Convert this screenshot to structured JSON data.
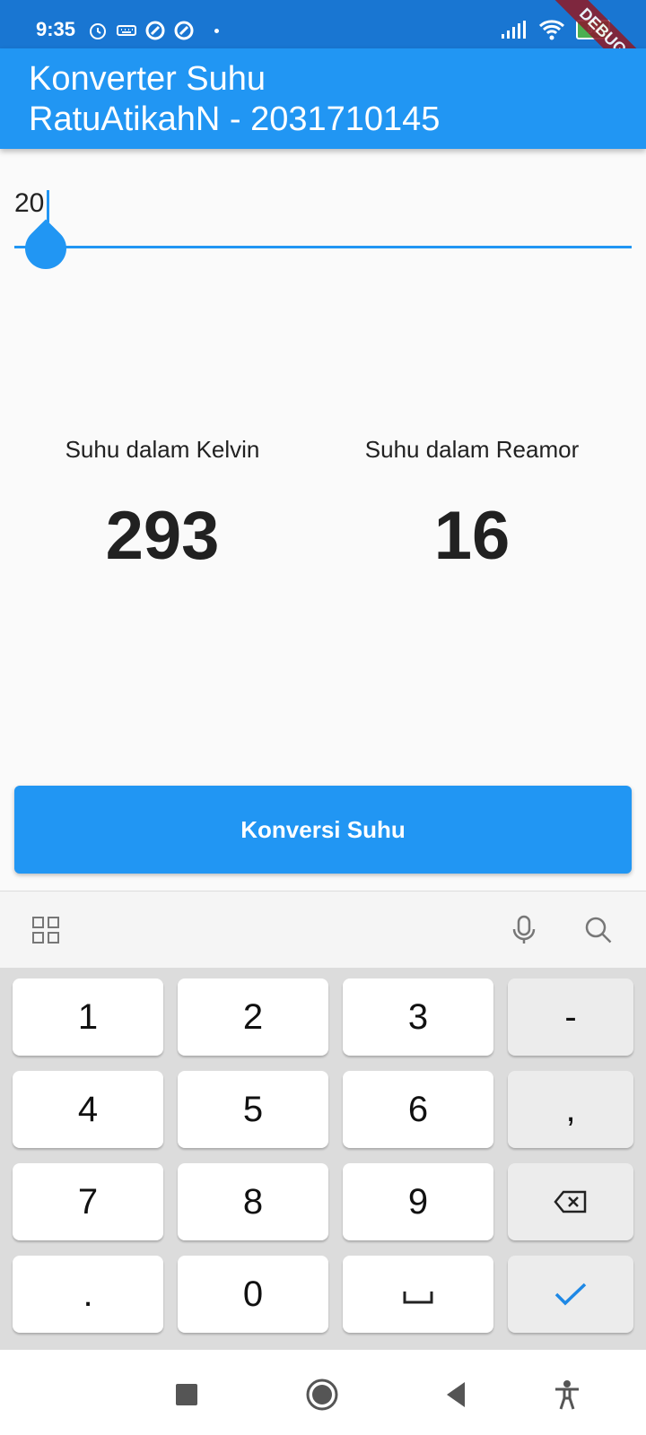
{
  "status": {
    "time": "9:35",
    "battery": "99"
  },
  "debug_banner": "DEBUG",
  "appbar": {
    "title": "Konverter Suhu",
    "subtitle": "RatuAtikahN - 2031710145"
  },
  "input": {
    "value": "20"
  },
  "results": {
    "kelvin_label": "Suhu dalam Kelvin",
    "kelvin_value": "293",
    "reamur_label": "Suhu dalam Reamor",
    "reamur_value": "16"
  },
  "button": {
    "label": "Konversi Suhu"
  },
  "keyboard": {
    "rows": [
      [
        "1",
        "2",
        "3",
        "-"
      ],
      [
        "4",
        "5",
        "6",
        ","
      ],
      [
        "7",
        "8",
        "9",
        "backspace"
      ],
      [
        ".",
        "0",
        "space",
        "done"
      ]
    ],
    "toolbar_icons": [
      "grid-icon",
      "mic-icon",
      "search-icon"
    ]
  },
  "colors": {
    "status_bar": "#1976d2",
    "app_bar": "#2196f3",
    "accent": "#2196f3"
  }
}
